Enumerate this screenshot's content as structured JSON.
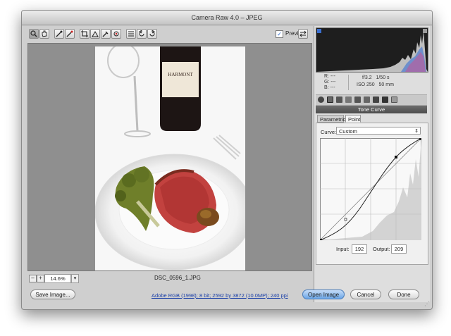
{
  "window": {
    "title": "Camera Raw 4.0  –  JPEG"
  },
  "toolbar": {
    "tools": [
      "zoom-tool-icon",
      "hand-tool-icon",
      "white-balance-tool-icon",
      "color-sampler-icon",
      "crop-tool-icon",
      "straighten-tool-icon",
      "retouch-tool-icon",
      "red-eye-icon",
      "preferences-icon",
      "rotate-left-icon",
      "rotate-right-icon"
    ],
    "preview_label": "Preview",
    "preview_checked": "✓"
  },
  "status": {
    "zoom_value": "14.6%",
    "zoom_minus": "–",
    "zoom_plus": "+",
    "filename": "DSC_0596_1.JPG",
    "bottle_label": "HARMONT"
  },
  "info": {
    "r_label": "R:",
    "g_label": "G:",
    "b_label": "B:",
    "r_value": "---",
    "g_value": "---",
    "b_value": "---",
    "aperture": "f/3.2",
    "shutter": "1/50 s",
    "iso": "ISO 250",
    "focal": "50 mm"
  },
  "panel": {
    "section_title": "Tone Curve",
    "tabs": [
      "Parametric",
      "Point"
    ],
    "curve_label": "Curve:",
    "curve_value": "Custom",
    "input_label": "Input:",
    "input_value": "192",
    "output_label": "Output:",
    "output_value": "209"
  },
  "bottom": {
    "save_label": "Save Image...",
    "info_link": "Adobe RGB (1998); 8 bit; 2592 by 3872 (10.0MP); 240 ppi",
    "open_label": "Open Image",
    "cancel_label": "Cancel",
    "done_label": "Done"
  },
  "colors": {
    "accent": "#6aa5e6",
    "canvas_bg": "#8f8f8f",
    "panel_bg": "#dedede"
  }
}
